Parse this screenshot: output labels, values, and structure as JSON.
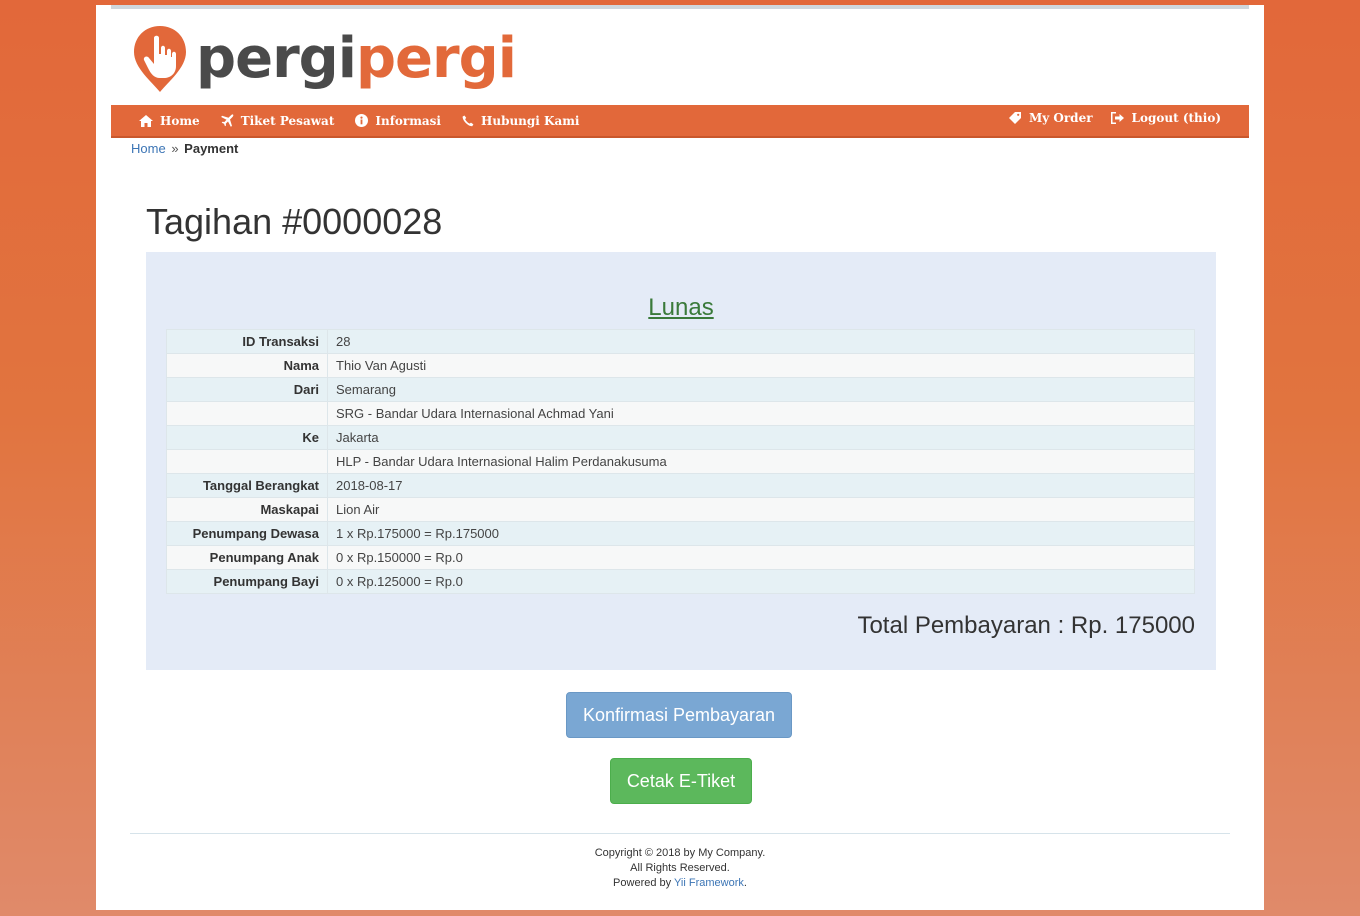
{
  "brand": {
    "logo_part1": "pergi",
    "logo_part2": "pergi",
    "accent_color": "#e2683a",
    "pin_icon": "hand-pointer-pin-icon"
  },
  "nav": {
    "left": [
      {
        "label": "Home",
        "icon": "home-icon"
      },
      {
        "label": "Tiket Pesawat",
        "icon": "plane-icon"
      },
      {
        "label": "Informasi",
        "icon": "info-circle-icon"
      },
      {
        "label": "Hubungi Kami",
        "icon": "phone-icon"
      }
    ],
    "right": [
      {
        "label": "My Order",
        "icon": "tag-icon"
      },
      {
        "label": "Logout (thio)",
        "icon": "logout-icon"
      }
    ]
  },
  "breadcrumb": {
    "home": "Home",
    "separator": "»",
    "current": "Payment"
  },
  "invoice": {
    "title": "Tagihan #0000028",
    "status": "Lunas",
    "rows": [
      {
        "label": "ID Transaksi",
        "value": "28"
      },
      {
        "label": "Nama",
        "value": "Thio Van Agusti"
      },
      {
        "label": "Dari",
        "value": "Semarang"
      },
      {
        "label": "",
        "value": "SRG - Bandar Udara Internasional Achmad Yani"
      },
      {
        "label": "Ke",
        "value": "Jakarta"
      },
      {
        "label": "",
        "value": "HLP - Bandar Udara Internasional Halim Perdanakusuma"
      },
      {
        "label": "Tanggal Berangkat",
        "value": "2018-08-17"
      },
      {
        "label": "Maskapai",
        "value": "Lion Air"
      },
      {
        "label": "Penumpang Dewasa",
        "value": "1 x Rp.175000 = Rp.175000"
      },
      {
        "label": "Penumpang Anak",
        "value": "0 x Rp.150000 = Rp.0"
      },
      {
        "label": "Penumpang Bayi",
        "value": "0 x Rp.125000 = Rp.0"
      }
    ],
    "total": "Total Pembayaran : Rp. 175000"
  },
  "actions": {
    "confirm_label": "Konfirmasi Pembayaran",
    "ticket_label": "Cetak E-Tiket"
  },
  "footer": {
    "copyright": "Copyright © 2018 by My Company.",
    "rights": "All Rights Reserved.",
    "powered_prefix": "Powered by",
    "powered_link": "Yii Framework",
    "powered_suffix": "."
  }
}
